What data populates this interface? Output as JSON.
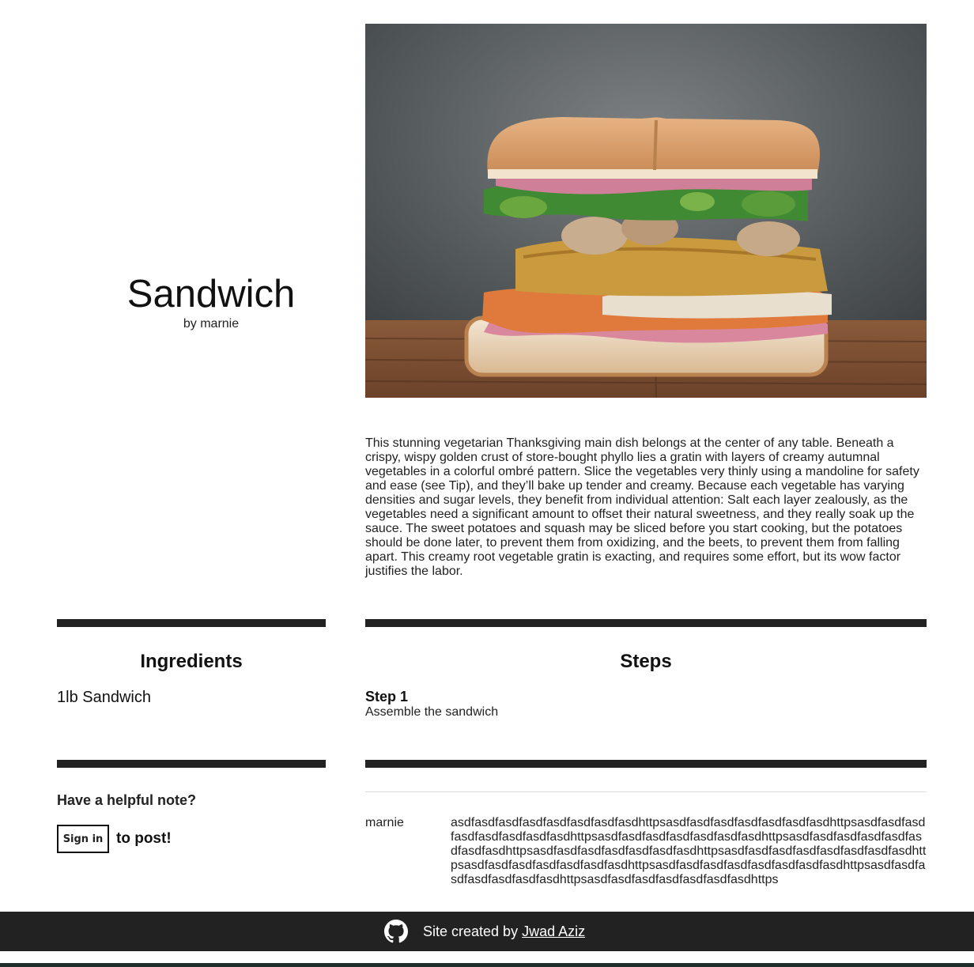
{
  "recipe": {
    "title": "Sandwich",
    "byline": "by marnie",
    "image_alt": "sandwich photo",
    "description": "This stunning vegetarian Thanksgiving main dish belongs at the center of any table. Beneath a crispy, wispy golden crust of store-bought phyllo lies a gratin with layers of creamy autumnal vegetables in a colorful ombré pattern. Slice the vegetables very thinly using a mandoline for safety and ease (see Tip), and they’ll bake up tender and creamy. Because each vegetable has varying densities and sugar levels, they benefit from individual attention: Salt each layer zealously, as the vegetables need a significant amount to offset their natural sweetness, and they really soak up the sauce. The sweet potatoes and squash may be sliced before you start cooking, but the potatoes should be done later, to prevent them from oxidizing, and the beets, to prevent them from falling apart. This creamy root vegetable gratin is exacting, and requires some effort, but its wow factor justifies the labor."
  },
  "ingredients": {
    "heading": "Ingredients",
    "items": [
      "1lb Sandwich"
    ]
  },
  "steps": {
    "heading": "Steps",
    "items": [
      {
        "title": "Step 1",
        "text": "Assemble the sandwich"
      }
    ]
  },
  "notes": {
    "prompt": "Have a helpful note?",
    "sign_in_label": "Sign in",
    "to_post": "to post!",
    "items": [
      {
        "author": "marnie",
        "text": "asdfasdfasdfasdfasdfasdfasdfasdhttpsasdfasdfasdfasdfasdfasdfasdhttpsasdfasdfasdfasdfasdfasdfasdfasdhttpsasdfasdfasdfasdfasdfasdfasdhttpsasdfasdfasdfasdfasdfasdfasdfasdhttpsasdfasdfasdfasdfasdfasdfasdhttpsasdfasdfasdfasdfasdfasdfasdfasdhttpsasdfasdfasdfasdfasdfasdfasdhttpsasdfasdfasdfasdfasdfasdfasdfasdhttpsasdfasdfasdfasdfasdfasdfasdhttpsasdfasdfasdfasdfasdfasdfasdhttps"
      }
    ]
  },
  "footer": {
    "icon": "github-icon",
    "prefix": "Site created by ",
    "author_link": "Jwad Aziz"
  },
  "colors": {
    "divider": "#222222",
    "footer_bg": "#222222",
    "bottom_band": "#1f2d2a"
  }
}
